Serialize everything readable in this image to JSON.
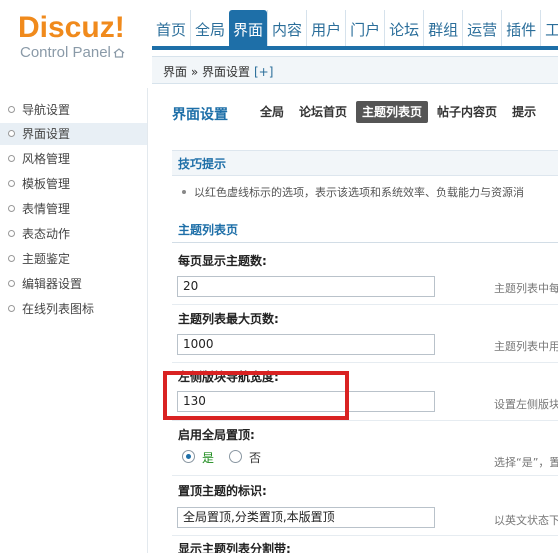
{
  "header": {
    "logo_main": "Discuz!",
    "logo_sub": "Control Panel",
    "brand_color": "#f08a1c",
    "nav": [
      "首页",
      "全局",
      "界面",
      "内容",
      "用户",
      "门户",
      "论坛",
      "群组",
      "运营",
      "插件",
      "工"
    ],
    "active_nav": "界面"
  },
  "breadcrumb": {
    "text": "界面 » 界面设置",
    "plus": "[+]"
  },
  "sidebar": {
    "items": [
      "导航设置",
      "界面设置",
      "风格管理",
      "模板管理",
      "表情管理",
      "表态动作",
      "主题鉴定",
      "编辑器设置",
      "在线列表图标"
    ],
    "active": "界面设置"
  },
  "main": {
    "title": "界面设置",
    "tabs": [
      "全局",
      "论坛首页",
      "主题列表页",
      "帖子内容页",
      "提示"
    ],
    "active_tab": "主题列表页",
    "tips": {
      "title": "技巧提示",
      "text": "以红色虚线标示的选项，表示该选项和系统效率、负载能力与资源消"
    },
    "section_title": "主题列表页",
    "fields": [
      {
        "label": "每页显示主题数:",
        "value": "20",
        "help": "主题列表中每"
      },
      {
        "label": "主题列表最大页数:",
        "value": "1000",
        "help": "主题列表中用"
      },
      {
        "label": "左侧版块导航宽度:",
        "value": "130",
        "help": "设置左侧版块"
      },
      {
        "label": "启用全局置顶:",
        "radio_yes": "是",
        "radio_no": "否",
        "selected": "是",
        "help": "选择“是”，置"
      },
      {
        "label": "置顶主题的标识:",
        "value": "全局置顶,分类置顶,本版置顶",
        "help": "以英文状态下"
      },
      {
        "label": "显示主题列表分割带:"
      }
    ]
  },
  "colors": {
    "accent": "#1e6fa8",
    "highlight_box": "#d92222"
  }
}
